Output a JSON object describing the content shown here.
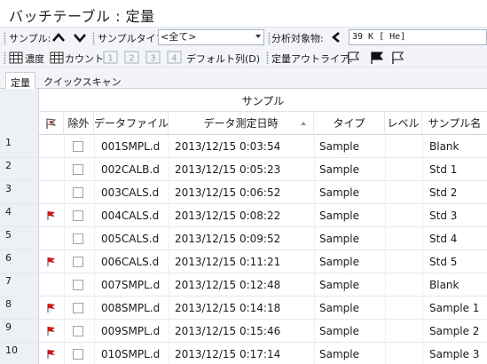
{
  "title": "バッチテーブル : 定量",
  "toolbar": {
    "sample_label": "サンプル:",
    "sample_type_label": "サンプルタイプ:",
    "sample_type_value": "<全て>",
    "analyte_label": "分析対象物:",
    "analyte_value": "39  K [ He]",
    "concentration_label": "濃度",
    "count_label": "カウント",
    "btn1": "1",
    "btn2": "2",
    "btn3": "3",
    "btn4": "4",
    "default_cols_label": "デフォルト列(D)",
    "outlier_label": "定量アウトライア:"
  },
  "tabs": [
    {
      "label": "定量",
      "active": true
    },
    {
      "label": "クイックスキャン",
      "active": false
    }
  ],
  "table": {
    "group_header": "サンプル",
    "columns": {
      "exclude": "除外",
      "data_file": "データファイル",
      "acq_time": "データ測定日時",
      "type": "タイプ",
      "level": "レベル",
      "sample_name": "サンプル名"
    },
    "rows": [
      {
        "num": "1",
        "flag": false,
        "file": "001SMPL.d",
        "time": "2013/12/15 0:03:54",
        "type": "Sample",
        "level": "",
        "name": "Blank"
      },
      {
        "num": "2",
        "flag": false,
        "file": "002CALB.d",
        "time": "2013/12/15 0:05:23",
        "type": "Sample",
        "level": "",
        "name": "Std 1"
      },
      {
        "num": "3",
        "flag": false,
        "file": "003CALS.d",
        "time": "2013/12/15 0:06:52",
        "type": "Sample",
        "level": "",
        "name": "Std 2"
      },
      {
        "num": "4",
        "flag": true,
        "file": "004CALS.d",
        "time": "2013/12/15 0:08:22",
        "type": "Sample",
        "level": "",
        "name": "Std 3"
      },
      {
        "num": "5",
        "flag": false,
        "file": "005CALS.d",
        "time": "2013/12/15 0:09:52",
        "type": "Sample",
        "level": "",
        "name": "Std 4"
      },
      {
        "num": "6",
        "flag": true,
        "file": "006CALS.d",
        "time": "2013/12/15 0:11:21",
        "type": "Sample",
        "level": "",
        "name": "Std 5"
      },
      {
        "num": "7",
        "flag": false,
        "file": "007SMPL.d",
        "time": "2013/12/15 0:12:48",
        "type": "Sample",
        "level": "",
        "name": "Blank"
      },
      {
        "num": "8",
        "flag": true,
        "file": "008SMPL.d",
        "time": "2013/12/15 0:14:18",
        "type": "Sample",
        "level": "",
        "name": "Sample 1"
      },
      {
        "num": "9",
        "flag": true,
        "file": "009SMPL.d",
        "time": "2013/12/15 0:15:46",
        "type": "Sample",
        "level": "",
        "name": "Sample 2"
      },
      {
        "num": "10",
        "flag": true,
        "file": "010SMPL.d",
        "time": "2013/12/15 0:17:14",
        "type": "Sample",
        "level": "",
        "name": "Sample 3"
      }
    ]
  },
  "colors": {
    "flag_red": "#cc1a1a",
    "toolbar_bg": "#f2f4f8",
    "rownum_bg": "#edf0f5"
  }
}
